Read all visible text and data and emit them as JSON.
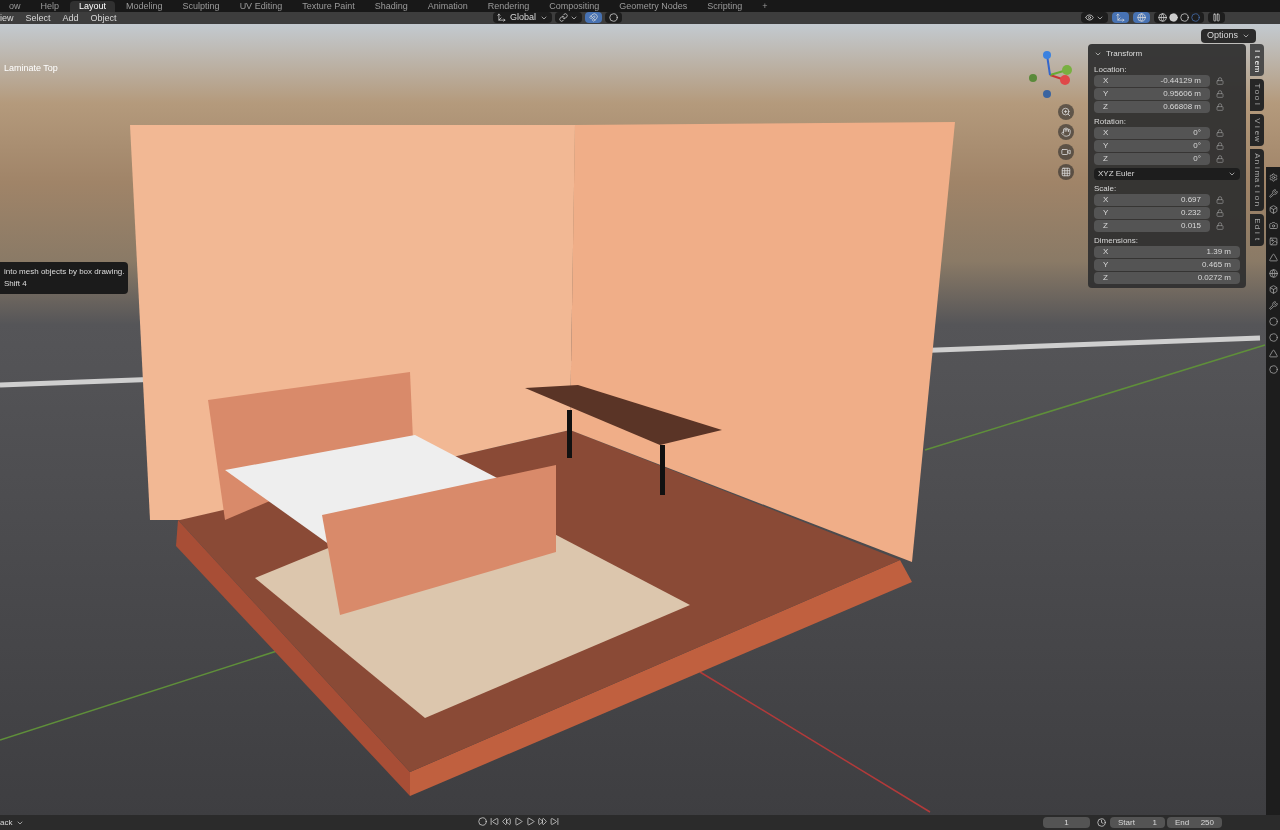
{
  "workspace_tabs": [
    {
      "label": "ow",
      "selected": false
    },
    {
      "label": "Help",
      "selected": false
    },
    {
      "label": "Layout",
      "selected": true
    },
    {
      "label": "Modeling",
      "selected": false
    },
    {
      "label": "Sculpting",
      "selected": false
    },
    {
      "label": "UV Editing",
      "selected": false
    },
    {
      "label": "Texture Paint",
      "selected": false
    },
    {
      "label": "Shading",
      "selected": false
    },
    {
      "label": "Animation",
      "selected": false
    },
    {
      "label": "Rendering",
      "selected": false
    },
    {
      "label": "Compositing",
      "selected": false
    },
    {
      "label": "Geometry Nodes",
      "selected": false
    },
    {
      "label": "Scripting",
      "selected": false
    },
    {
      "label": "+",
      "selected": false
    }
  ],
  "header_menu": [
    "iew",
    "Select",
    "Add",
    "Object"
  ],
  "transform_orientation": "Global",
  "options_button": "Options",
  "object_label": "Laminate Top",
  "tooltip": {
    "lines": [
      "into mesh objects by box drawing.",
      "Shift 4"
    ]
  },
  "sidebar": {
    "tabs": [
      {
        "label": "Item",
        "selected": true
      },
      {
        "label": "Tool",
        "selected": false
      },
      {
        "label": "View",
        "selected": false
      },
      {
        "label": "Animation",
        "selected": false
      },
      {
        "label": "Edit",
        "selected": false
      }
    ],
    "panel": {
      "title": "Transform",
      "expanded": true,
      "groups": [
        {
          "label": "Location:",
          "kind": "lockable",
          "rows": [
            {
              "axis": "X",
              "value": "-0.44129 m"
            },
            {
              "axis": "Y",
              "value": "0.95606 m"
            },
            {
              "axis": "Z",
              "value": "0.66808 m"
            }
          ]
        },
        {
          "label": "Rotation:",
          "kind": "lockable",
          "rows": [
            {
              "axis": "X",
              "value": "0°"
            },
            {
              "axis": "Y",
              "value": "0°"
            },
            {
              "axis": "Z",
              "value": "0°"
            }
          ],
          "mode": "XYZ Euler"
        },
        {
          "label": "Scale:",
          "kind": "lockable",
          "rows": [
            {
              "axis": "X",
              "value": "0.697"
            },
            {
              "axis": "Y",
              "value": "0.232"
            },
            {
              "axis": "Z",
              "value": "0.015"
            }
          ]
        },
        {
          "label": "Dimensions:",
          "kind": "plain",
          "rows": [
            {
              "axis": "X",
              "value": "1.39 m"
            },
            {
              "axis": "Y",
              "value": "0.465 m"
            },
            {
              "axis": "Z",
              "value": "0.0272 m"
            }
          ]
        }
      ]
    }
  },
  "timeline": {
    "menu": "ack",
    "current_frame": "1",
    "start_label": "Start",
    "start": "1",
    "end_label": "End",
    "end": "250"
  }
}
